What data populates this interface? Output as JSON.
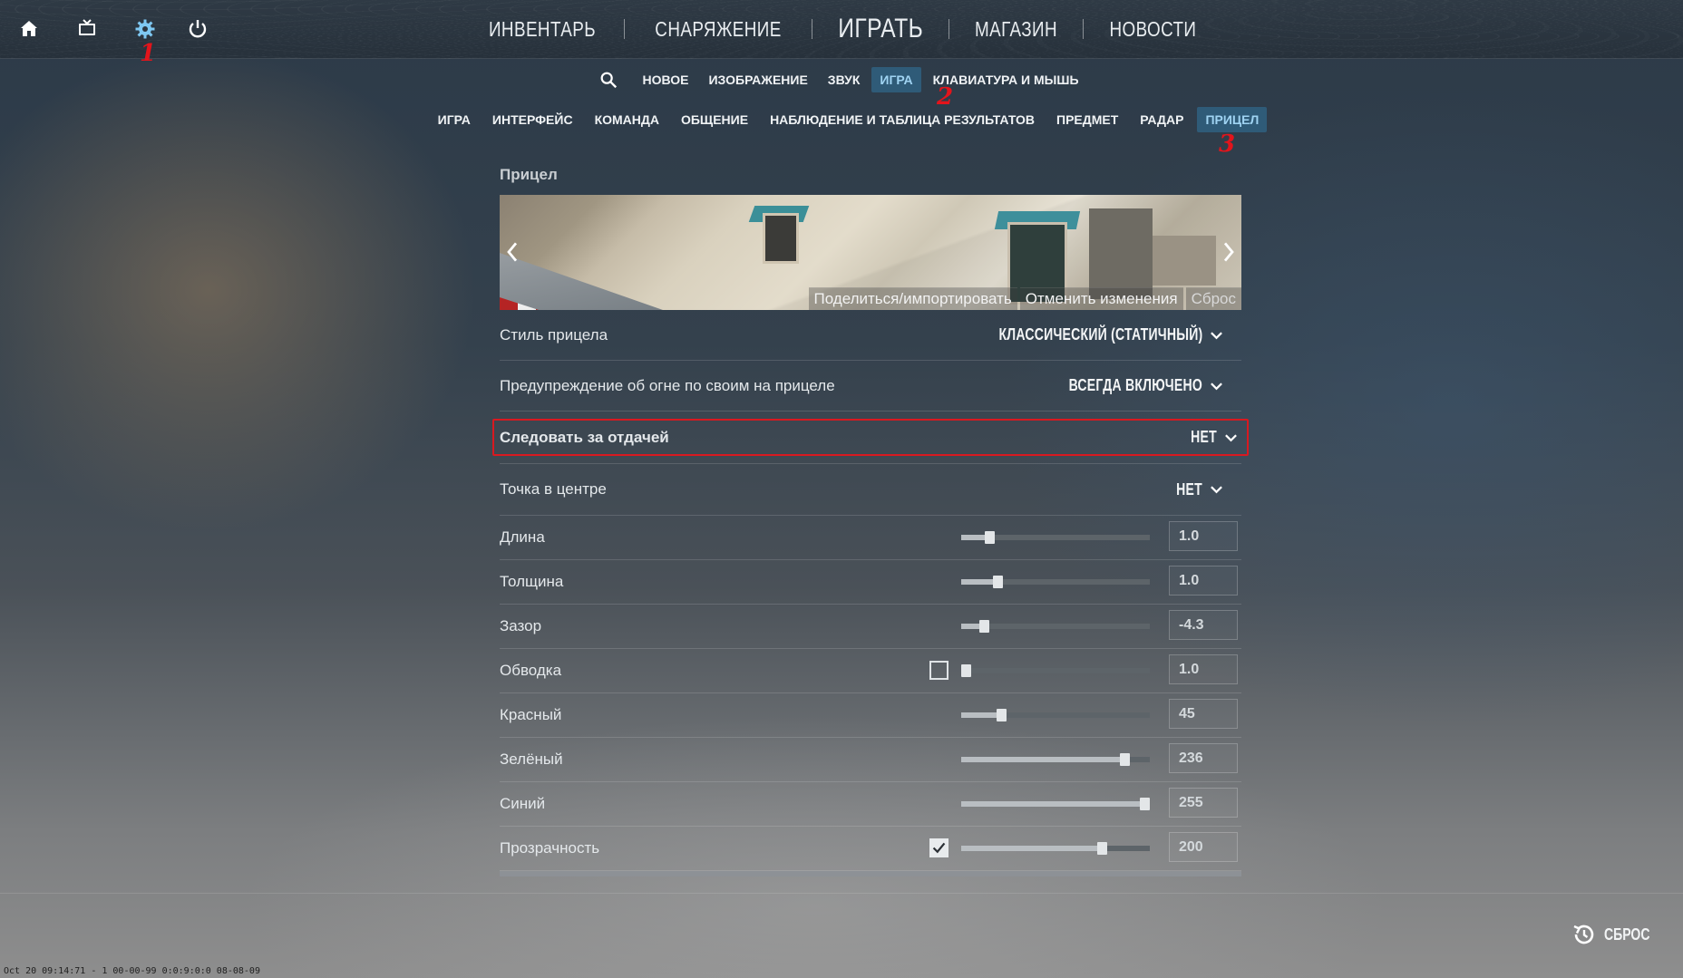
{
  "topbar": {
    "icons": [
      "home-icon",
      "tv-icon",
      "gear-icon",
      "power-icon"
    ],
    "nav": [
      {
        "label": "ИНВЕНТАРЬ"
      },
      {
        "label": "СНАРЯЖЕНИЕ"
      },
      {
        "label": "ИГРАТЬ"
      },
      {
        "label": "МАГАЗИН"
      },
      {
        "label": "НОВОСТИ"
      }
    ]
  },
  "annotations": {
    "a1": "1",
    "a2": "2",
    "a3": "3"
  },
  "subnav": {
    "tabs": [
      "НОВОЕ",
      "ИЗОБРАЖЕНИЕ",
      "ЗВУК",
      "ИГРА",
      "КЛАВИАТУРА И МЫШЬ"
    ],
    "active": "ИГРА"
  },
  "subnav2": {
    "tabs": [
      "ИГРА",
      "ИНТЕРФЕЙС",
      "КОМАНДА",
      "ОБЩЕНИЕ",
      "НАБЛЮДЕНИЕ И ТАБЛИЦА РЕЗУЛЬТАТОВ",
      "ПРЕДМЕТ",
      "РАДАР",
      "ПРИЦЕЛ"
    ],
    "active": "ПРИЦЕЛ"
  },
  "section": {
    "title": "Прицел"
  },
  "preview": {
    "share_label": "Поделиться/импортировать",
    "revert_label": "Отменить изменения",
    "reset_label": "Сброс"
  },
  "dropdowns": [
    {
      "label": "Стиль прицела",
      "value": "КЛАССИЧЕСКИЙ (СТАТИЧНЫЙ)"
    },
    {
      "label": "Предупреждение об огне по своим на прицеле",
      "value": "ВСЕГДА ВКЛЮЧЕНО"
    },
    {
      "label": "Следовать за отдачей",
      "value": "НЕТ"
    },
    {
      "label": "Точка в центре",
      "value": "НЕТ"
    }
  ],
  "sliders": [
    {
      "label": "Длина",
      "value": "1.0",
      "level": 0.13
    },
    {
      "label": "Толщина",
      "value": "1.0",
      "level": 0.18
    },
    {
      "label": "Зазор",
      "value": "-4.3",
      "level": 0.1
    },
    {
      "label": "Обводка",
      "value": "1.0",
      "level": 0.0
    },
    {
      "label": "Красный",
      "value": "45",
      "level": 0.2
    },
    {
      "label": "Зелёный",
      "value": "236",
      "level": 0.89
    },
    {
      "label": "Синий",
      "value": "255",
      "level": 1.0
    },
    {
      "label": "Прозрачность",
      "value": "200",
      "level": 0.76
    }
  ],
  "footer": {
    "reset_label": "СБРОС"
  },
  "stamp": "Oct 20 09:14:71 - 1 00-00-99 0:0:9:0:0 08-08-09"
}
